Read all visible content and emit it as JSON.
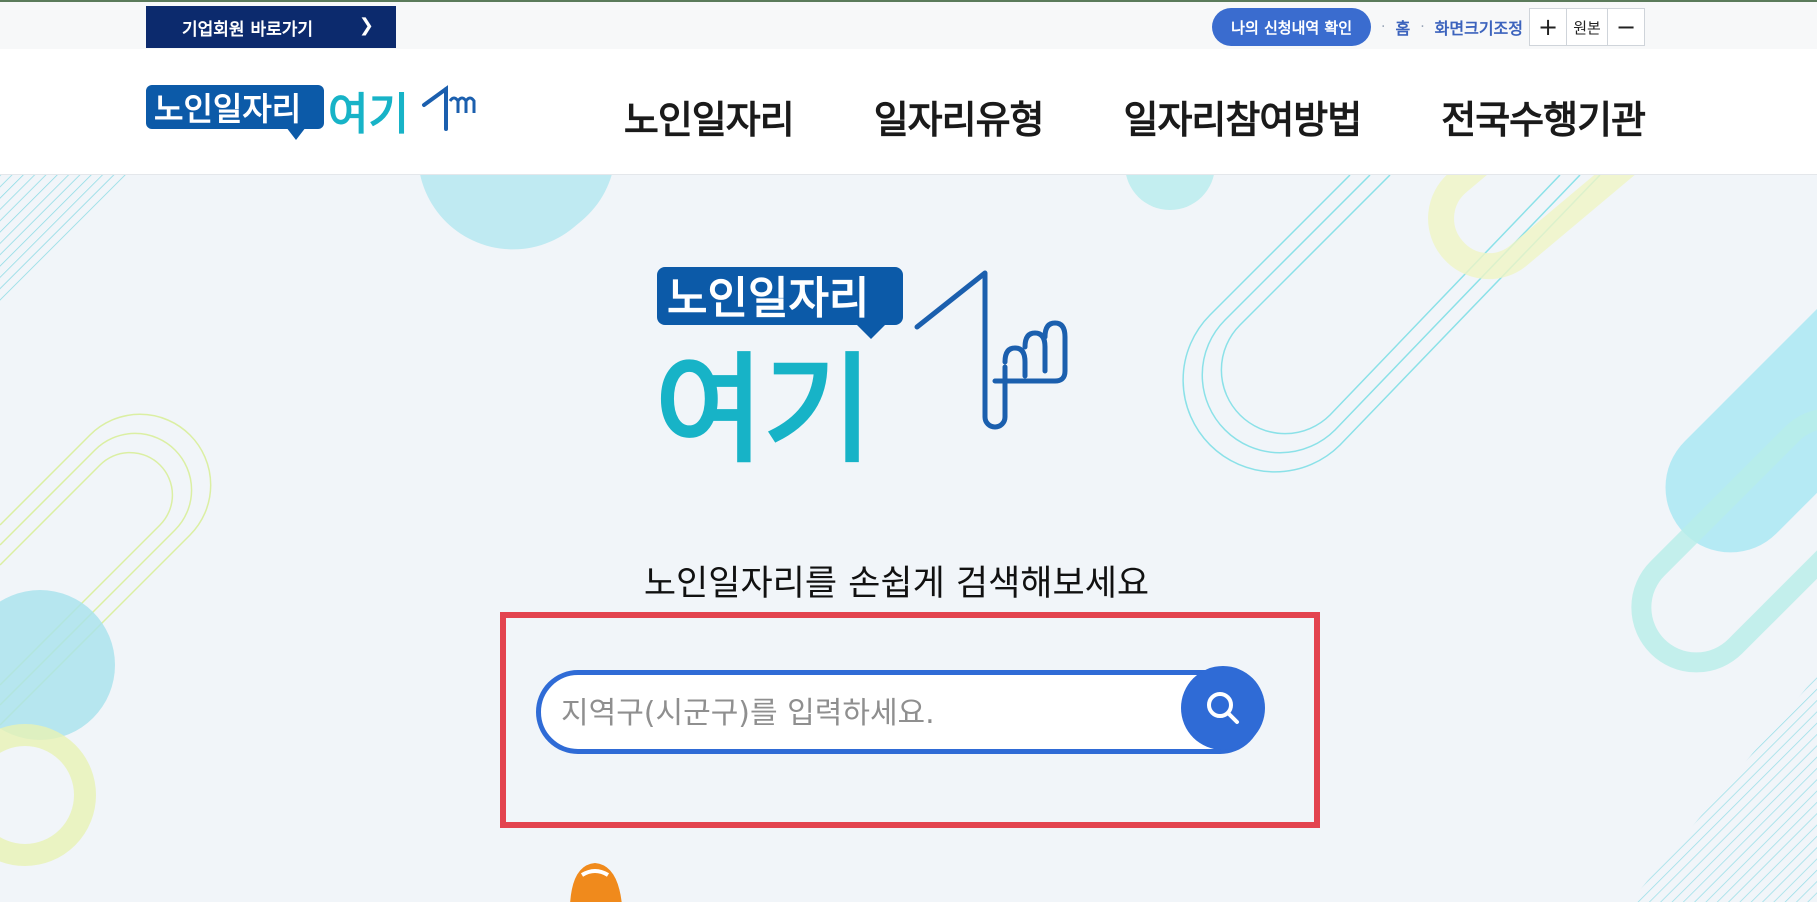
{
  "topbar": {
    "corp_link": "기업회원 바로가기",
    "my_applications": "나의 신청내역 확인",
    "home": "홈",
    "zoom_label": "화면크기조정",
    "zoom_in": "+",
    "zoom_reset": "원본",
    "zoom_out": "−"
  },
  "logo": {
    "text_top": "노인일자리",
    "text_bottom": "여기"
  },
  "nav": {
    "items": [
      "노인일자리",
      "일자리유형",
      "일자리참여방법",
      "전국수행기관"
    ]
  },
  "hero": {
    "tagline": "노인일자리를 손쉽게 검색해보세요",
    "search_placeholder": "지역구(시군구)를 입력하세요."
  },
  "colors": {
    "navy": "#0c2a6d",
    "blue": "#2f6bd6",
    "teal": "#17b3c7",
    "highlight": "#e3434f"
  }
}
